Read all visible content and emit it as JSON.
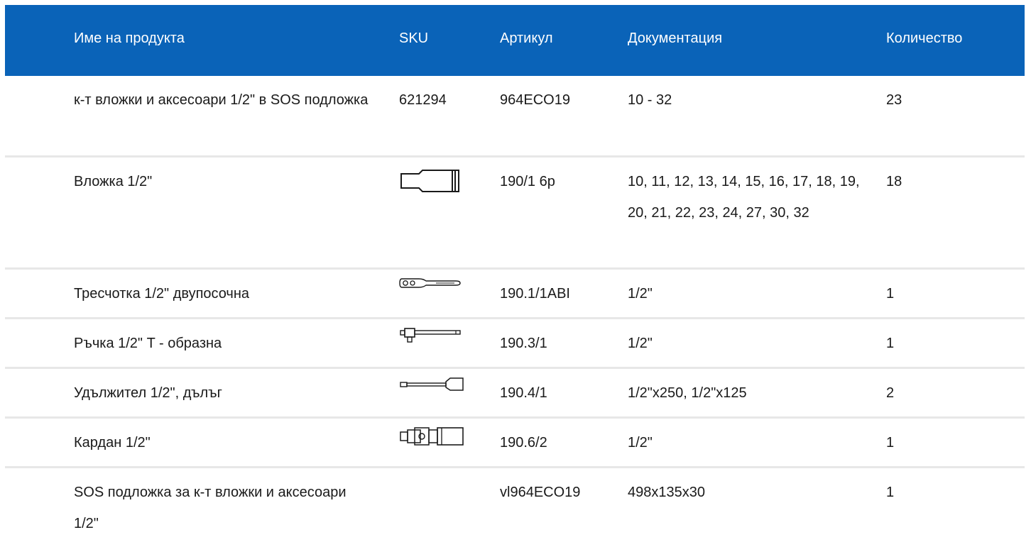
{
  "table": {
    "headers": {
      "name": "Име на продукта",
      "sku": "SKU",
      "article": "Артикул",
      "documentation": "Документация",
      "quantity": "Количество"
    },
    "rows": [
      {
        "name": "к-т вложки и аксесоари 1/2\" в SOS подложка",
        "sku": "621294",
        "sku_icon": null,
        "article": "964ECO19",
        "documentation": "10 - 32",
        "quantity": "23"
      },
      {
        "name": "Вложка 1/2\"",
        "sku": "",
        "sku_icon": "socket-icon",
        "article": "190/1 6p",
        "documentation": "10, 11, 12, 13, 14, 15, 16, 17, 18, 19, 20, 21, 22, 23, 24, 27, 30, 32",
        "quantity": "18"
      },
      {
        "name": "Тресчотка 1/2\" двупосочна",
        "sku": "",
        "sku_icon": "ratchet-icon",
        "article": "190.1/1ABI",
        "documentation": "1/2\"",
        "quantity": "1"
      },
      {
        "name": "Ръчка 1/2\" T - образна",
        "sku": "",
        "sku_icon": "t-handle-icon",
        "article": "190.3/1",
        "documentation": "1/2\"",
        "quantity": "1"
      },
      {
        "name": "Удължител 1/2\", дълъг",
        "sku": "",
        "sku_icon": "extension-bar-icon",
        "article": "190.4/1",
        "documentation": "1/2\"x250, 1/2\"x125",
        "quantity": "2"
      },
      {
        "name": "Кардан 1/2\"",
        "sku": "",
        "sku_icon": "universal-joint-icon",
        "article": "190.6/2",
        "documentation": "1/2\"",
        "quantity": "1"
      },
      {
        "name": "SOS подложка за к-т вложки и аксесоари 1/2\"",
        "sku": "",
        "sku_icon": null,
        "article": "vl964ECO19",
        "documentation": "498x135x30",
        "quantity": "1"
      }
    ]
  }
}
